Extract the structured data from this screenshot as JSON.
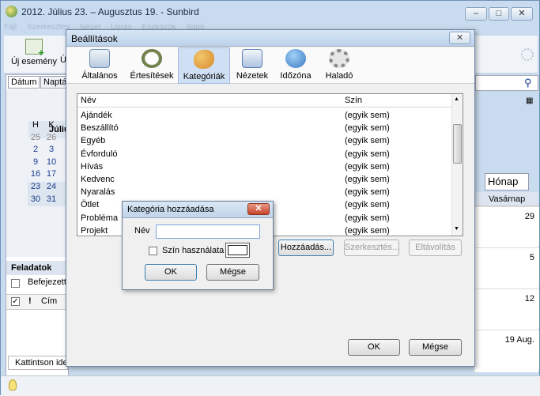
{
  "app": {
    "title": "2012. Július 23. – Augusztus 19. - Sunbird",
    "window_buttons": [
      "–",
      "□",
      "✕"
    ]
  },
  "menubar": {
    "items": [
      "Fájl",
      "Szerkesztés",
      "Nézet",
      "Ugrás",
      "Eszközök",
      "Súgó"
    ]
  },
  "toolbar": {
    "new_event": "Új esemény",
    "new_task_partial": "Ú"
  },
  "left_pane": {
    "tab_date": "Dátum",
    "tab_calendars": "Naptá",
    "month_label": "Júliu",
    "weekday_headers": [
      "H",
      "K"
    ],
    "weeks": [
      [
        {
          "d": "25",
          "m": "other"
        },
        {
          "d": "26",
          "m": "other"
        }
      ],
      [
        {
          "d": "2",
          "m": "cur"
        },
        {
          "d": "3",
          "m": "cur"
        }
      ],
      [
        {
          "d": "9",
          "m": "cur"
        },
        {
          "d": "10",
          "m": "cur"
        }
      ],
      [
        {
          "d": "16",
          "m": "cur"
        },
        {
          "d": "17",
          "m": "cur"
        }
      ],
      [
        {
          "d": "23",
          "m": "cur"
        },
        {
          "d": "24",
          "m": "cur"
        }
      ],
      [
        {
          "d": "30",
          "m": "cur"
        },
        {
          "d": "31",
          "m": "cur"
        }
      ]
    ],
    "tasks_header": "Feladatok",
    "show_completed": "Befejezett",
    "title_col": "Cím",
    "quick_add_placeholder": "Kattintson ide"
  },
  "calendar": {
    "month_tab": "Hónap",
    "day_header": "Vasárnap",
    "day_numbers": [
      "29",
      "5",
      "12",
      "19 Aug."
    ]
  },
  "prefs_dialog": {
    "title": "Beállítások",
    "close_label": "✕",
    "tabs": [
      {
        "label": "Általános",
        "icon": "general-icon",
        "color": "#6b8fb3"
      },
      {
        "label": "Értesítések",
        "icon": "alarm-clock-icon",
        "color": "#7a8a55"
      },
      {
        "label": "Kategóriák",
        "icon": "palette-icon",
        "color": "#d7892f"
      },
      {
        "label": "Nézetek",
        "icon": "views-icon",
        "color": "#5b7db5"
      },
      {
        "label": "Időzóna",
        "icon": "timezone-globe-icon",
        "color": "#3a78c2"
      },
      {
        "label": "Haladó",
        "icon": "gear-icon",
        "color": "#8a8a8a"
      }
    ],
    "selected_tab": "Kategóriák",
    "columns": {
      "name": "Név",
      "color": "Szín"
    },
    "categories": [
      {
        "name": "Ajándék",
        "color": "(egyik sem)"
      },
      {
        "name": "Beszállító",
        "color": "(egyik sem)"
      },
      {
        "name": "Egyéb",
        "color": "(egyik sem)"
      },
      {
        "name": "Évforduló",
        "color": "(egyik sem)"
      },
      {
        "name": "Hívás",
        "color": "(egyik sem)"
      },
      {
        "name": "Kedvenc",
        "color": "(egyik sem)"
      },
      {
        "name": "Nyaralás",
        "color": "(egyik sem)"
      },
      {
        "name": "Ötlet",
        "color": "(egyik sem)"
      },
      {
        "name": "Probléma",
        "color": "(egyik sem)"
      },
      {
        "name": "Projekt",
        "color": "(egyik sem)"
      }
    ],
    "buttons": {
      "add": "Hozzáadás...",
      "edit": "Szerkesztés...",
      "remove": "Eltávolítás",
      "ok": "OK",
      "cancel": "Mégse"
    }
  },
  "add_category_dialog": {
    "title": "Kategória hozzáadása",
    "name_label": "Név",
    "name_value": "",
    "use_color_label": "Szín használata",
    "ok": "OK",
    "cancel": "Mégse"
  },
  "colors": {
    "accent": "#cfe0f4",
    "titlebar": "#c9dbee",
    "close_red": "#c7432a"
  }
}
